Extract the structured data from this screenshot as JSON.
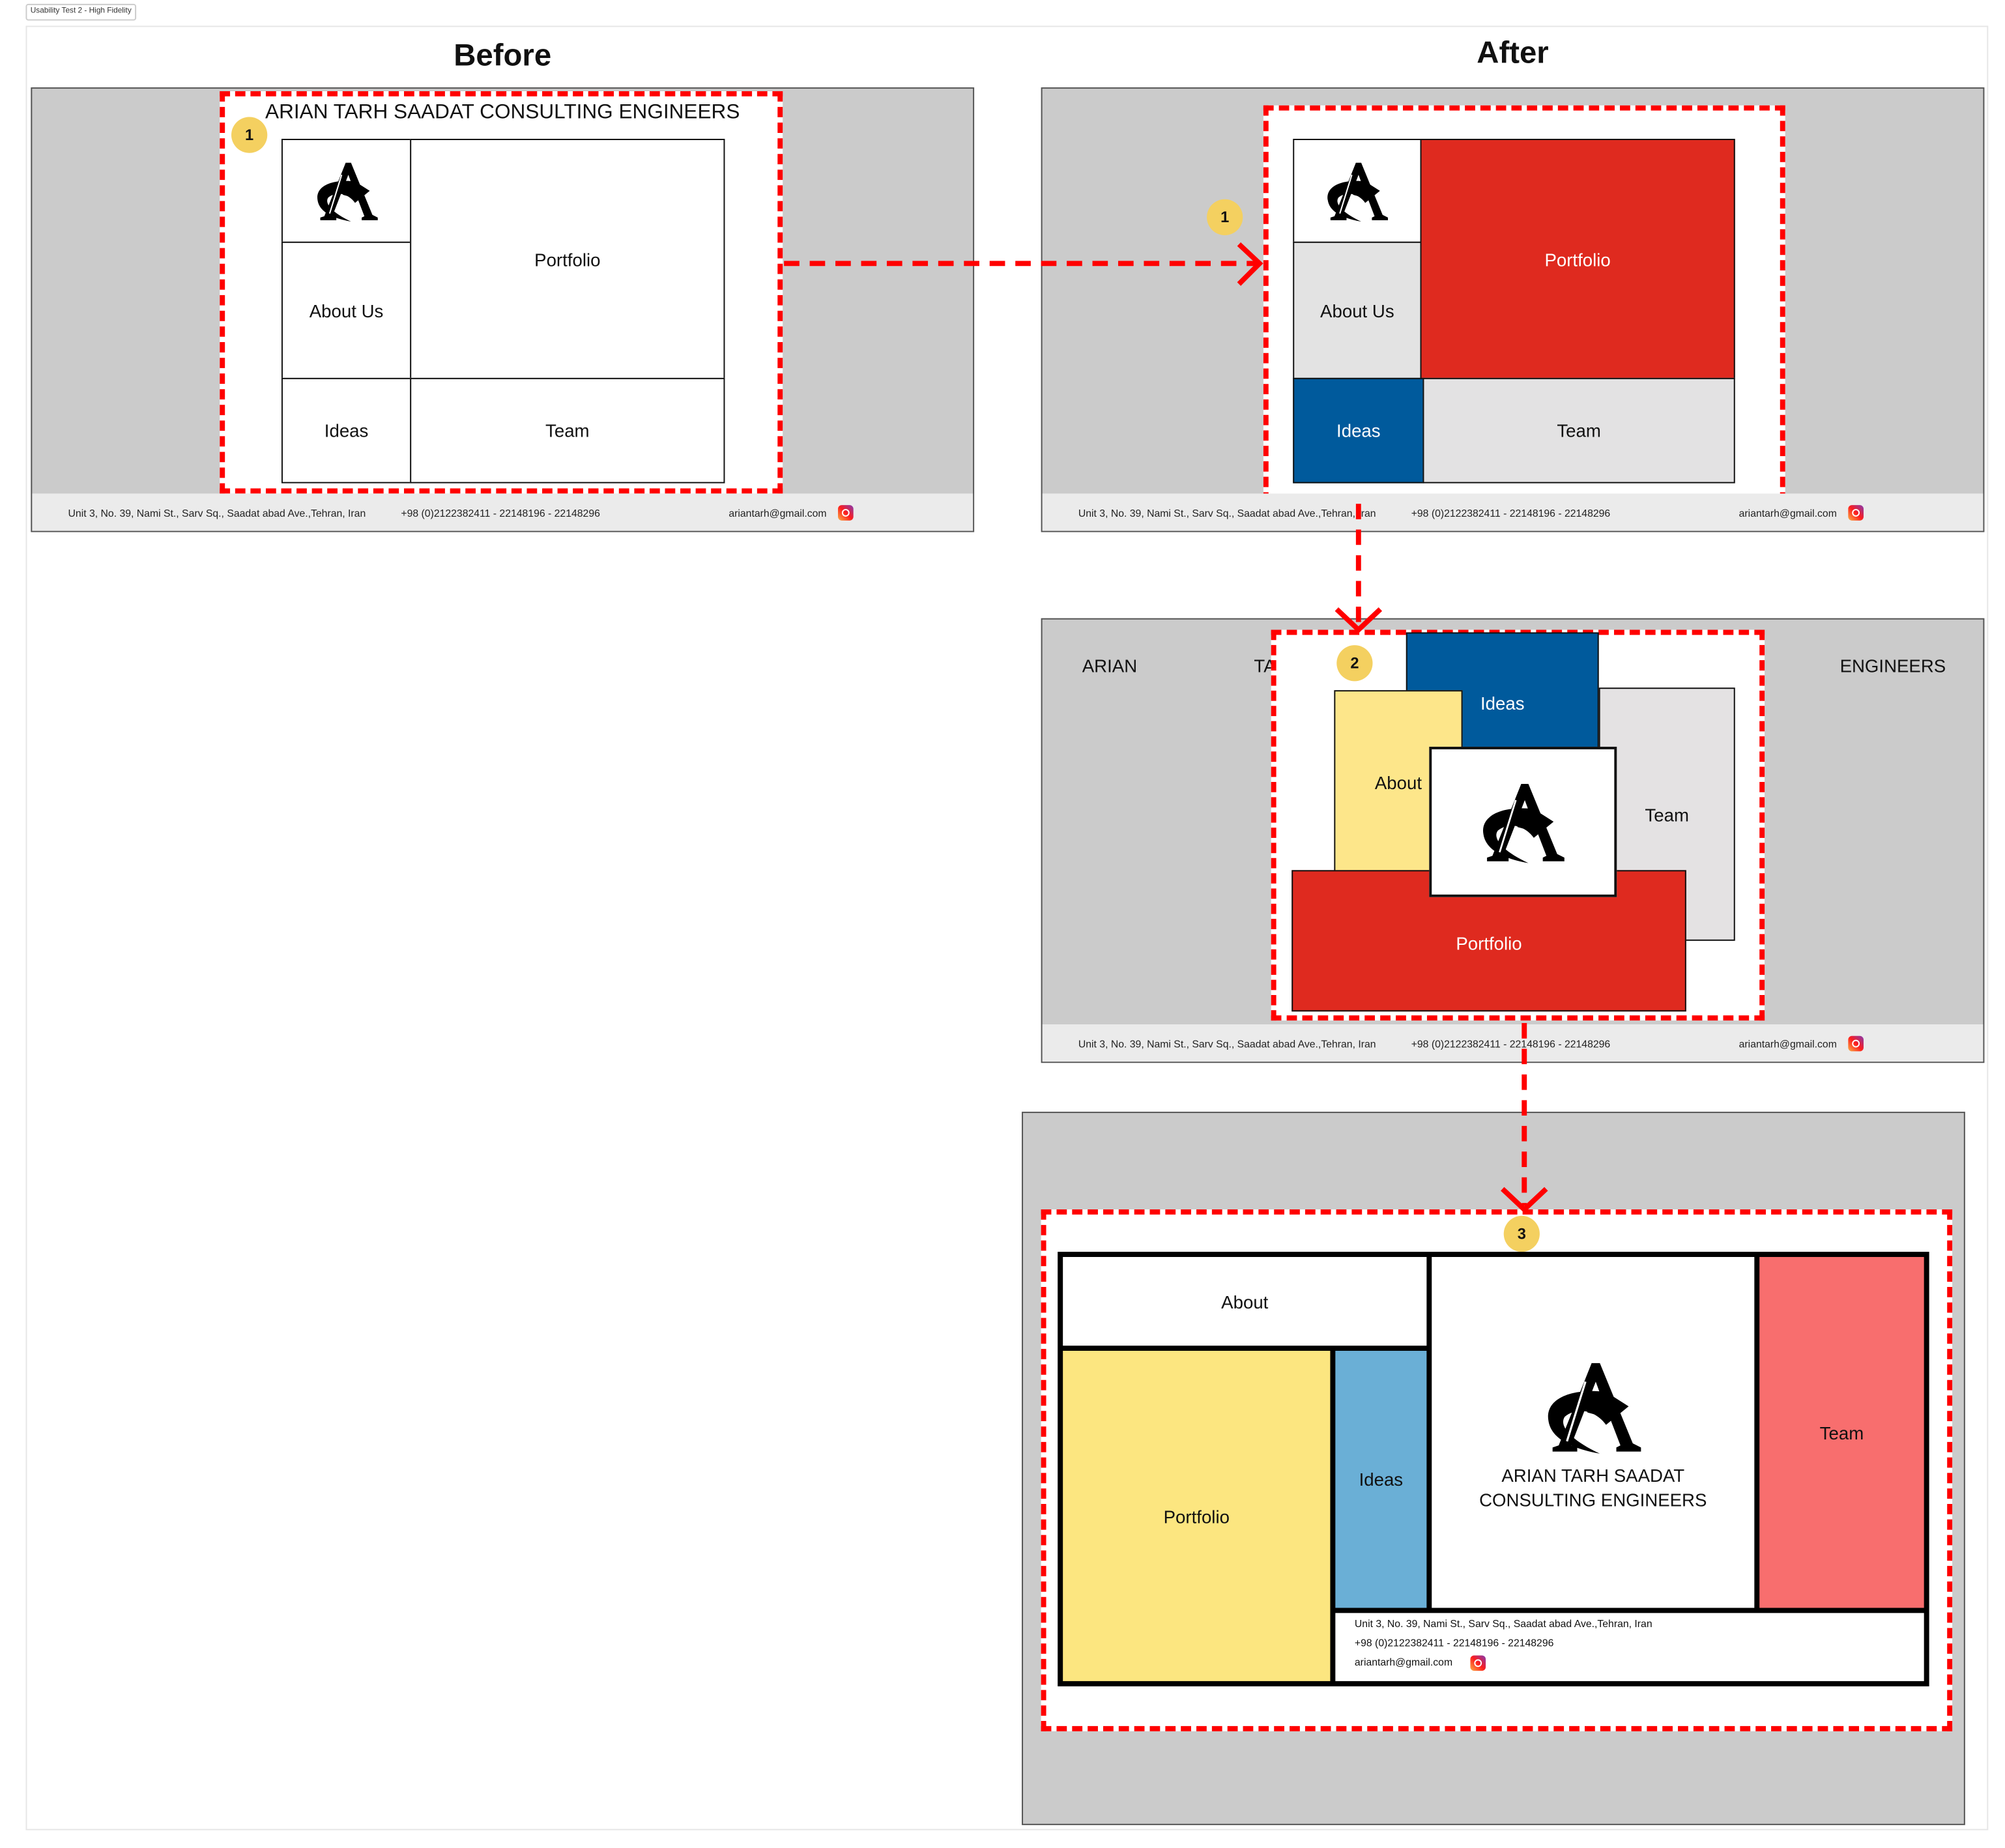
{
  "page_label": "Usability Test 2 - High Fidelity",
  "headings": {
    "before": "Before",
    "after": "After"
  },
  "company_name": "ARIAN TARH SAADAT CONSULTING ENGINEERS",
  "company_name_lines": [
    "ARIAN TARH SAADAT",
    "CONSULTING ENGINEERS"
  ],
  "footer": {
    "address": "Unit 3, No. 39, Nami St., Sarv Sq., Saadat abad Ave.,Tehran, Iran",
    "phone": "+98 (0)2122382411 - 22148196 - 22148296",
    "email": "ariantarh@gmail.com",
    "social_icon": "instagram-icon"
  },
  "badges": [
    "1",
    "1",
    "2",
    "3"
  ],
  "before": {
    "tiles": {
      "about": "About Us",
      "portfolio": "Portfolio",
      "ideas": "Ideas",
      "team": "Team"
    }
  },
  "after1": {
    "tiles": {
      "about": "About Us",
      "portfolio": "Portfolio",
      "ideas": "Ideas",
      "team": "Team"
    }
  },
  "after2": {
    "tiles": {
      "about": "About",
      "portfolio": "Portfolio",
      "ideas": "Ideas",
      "team": "Team"
    }
  },
  "after3": {
    "tiles": {
      "about": "About",
      "portfolio": "Portfolio",
      "ideas": "Ideas",
      "team": "Team"
    }
  },
  "colors": {
    "highlight": "#ff0000",
    "red": "#df2a1f",
    "blue": "#005a9c",
    "yellow": "#fde68a",
    "light_blue": "#6aafd6",
    "coral": "#f86e6e",
    "badge": "#f4d060"
  }
}
